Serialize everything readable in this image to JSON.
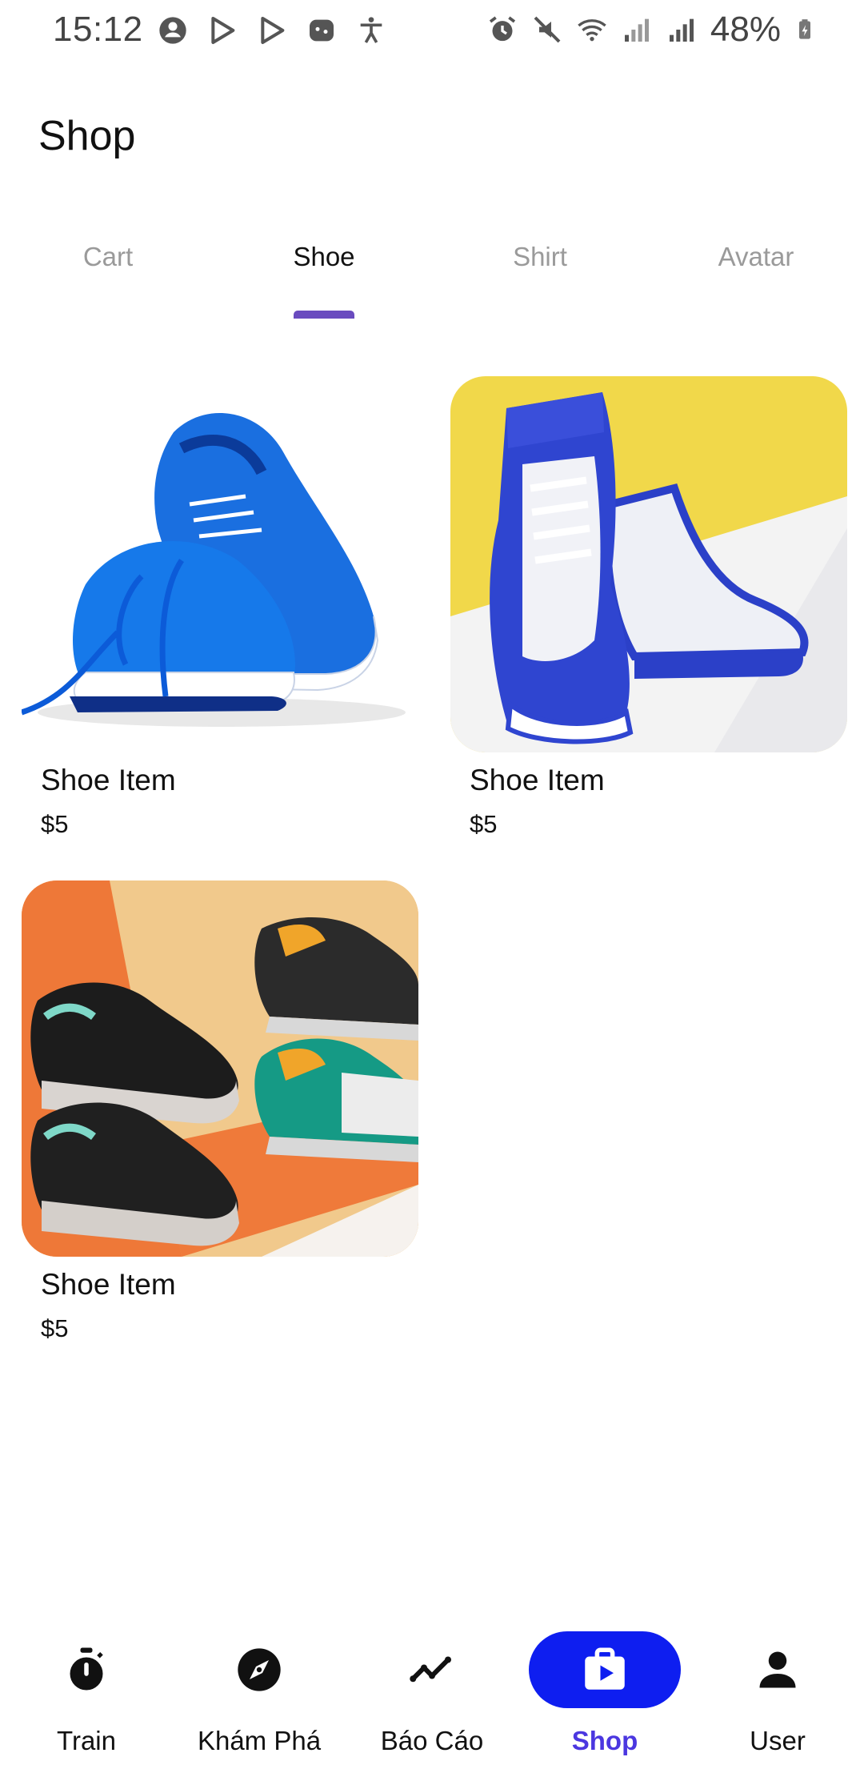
{
  "status_bar": {
    "time": "15:12",
    "battery": "48%",
    "left_icons": [
      "account-circle-icon",
      "play-store-icon",
      "play-store-icon",
      "game-icon",
      "accessibility-icon"
    ],
    "right_icons": [
      "alarm-icon",
      "mute-icon",
      "wifi-icon",
      "signal-icon",
      "signal-icon",
      "battery-charging-icon"
    ]
  },
  "header": {
    "title": "Shop"
  },
  "tabs": [
    {
      "label": "Cart",
      "active": false
    },
    {
      "label": "Shoe",
      "active": true
    },
    {
      "label": "Shirt",
      "active": false
    },
    {
      "label": "Avatar",
      "active": false
    }
  ],
  "products": [
    {
      "title": "Shoe Item",
      "price": "$5",
      "image": "blue-running-shoes"
    },
    {
      "title": "Shoe Item",
      "price": "$5",
      "image": "blue-white-high-top-sneakers"
    },
    {
      "title": "Shoe Item",
      "price": "$5",
      "image": "black-teal-sneakers"
    }
  ],
  "bottom_nav": [
    {
      "label": "Train",
      "icon": "stopwatch-icon",
      "active": false
    },
    {
      "label": "Khám Phá",
      "icon": "compass-icon",
      "active": false
    },
    {
      "label": "Báo Cáo",
      "icon": "trend-line-icon",
      "active": false
    },
    {
      "label": "Shop",
      "icon": "shopping-bag-icon",
      "active": true
    },
    {
      "label": "User",
      "icon": "person-icon",
      "active": false
    }
  ],
  "colors": {
    "accent": "#6a4bbf",
    "active_nav_bg": "#0e1ef0",
    "active_nav_label": "#4b37e0",
    "inactive_tab": "#9a9a9a"
  }
}
